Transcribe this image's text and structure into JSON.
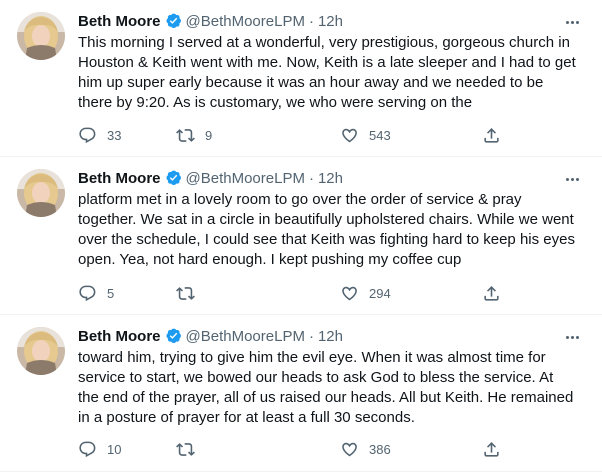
{
  "author": {
    "name": "Beth Moore",
    "handle": "@BethMooreLPM",
    "separator": "·",
    "avatar_icon": "profile-photo",
    "verified_icon": "verified-badge-icon",
    "verified_color": "#1d9bf0"
  },
  "tweets": [
    {
      "time": "12h",
      "text": "This morning I served at a wonderful, very prestigious, gorgeous church in Houston & Keith went with me. Now, Keith is a late sleeper and I had to get him up super early because it was an hour away and we needed to be there by 9:20. As is customary, we who were serving on the",
      "replies": "33",
      "retweets": "9",
      "likes": "543"
    },
    {
      "time": "12h",
      "text": "platform met in a lovely room to go over the order of service & pray together. We sat in a circle in beautifully upholstered chairs. While we went over the schedule, I could see that Keith was fighting hard to keep his eyes open. Yea, not hard enough. I kept pushing my coffee cup",
      "replies": "5",
      "retweets": "",
      "likes": "294"
    },
    {
      "time": "12h",
      "text": "toward him, trying to give him the evil eye. When it was almost time for service to start, we bowed our heads to ask God to bless the service. At the end of the prayer, all of us raised our heads. All but Keith. He remained in a posture of prayer for at least a full 30 seconds.",
      "replies": "10",
      "retweets": "",
      "likes": "386"
    }
  ],
  "icons": {
    "reply": "reply-icon",
    "retweet": "retweet-icon",
    "like": "like-icon",
    "share": "share-icon",
    "more": "more-options-icon"
  },
  "colors": {
    "text": "#0f1419",
    "secondary": "#536471",
    "divider": "#eff3f4"
  }
}
